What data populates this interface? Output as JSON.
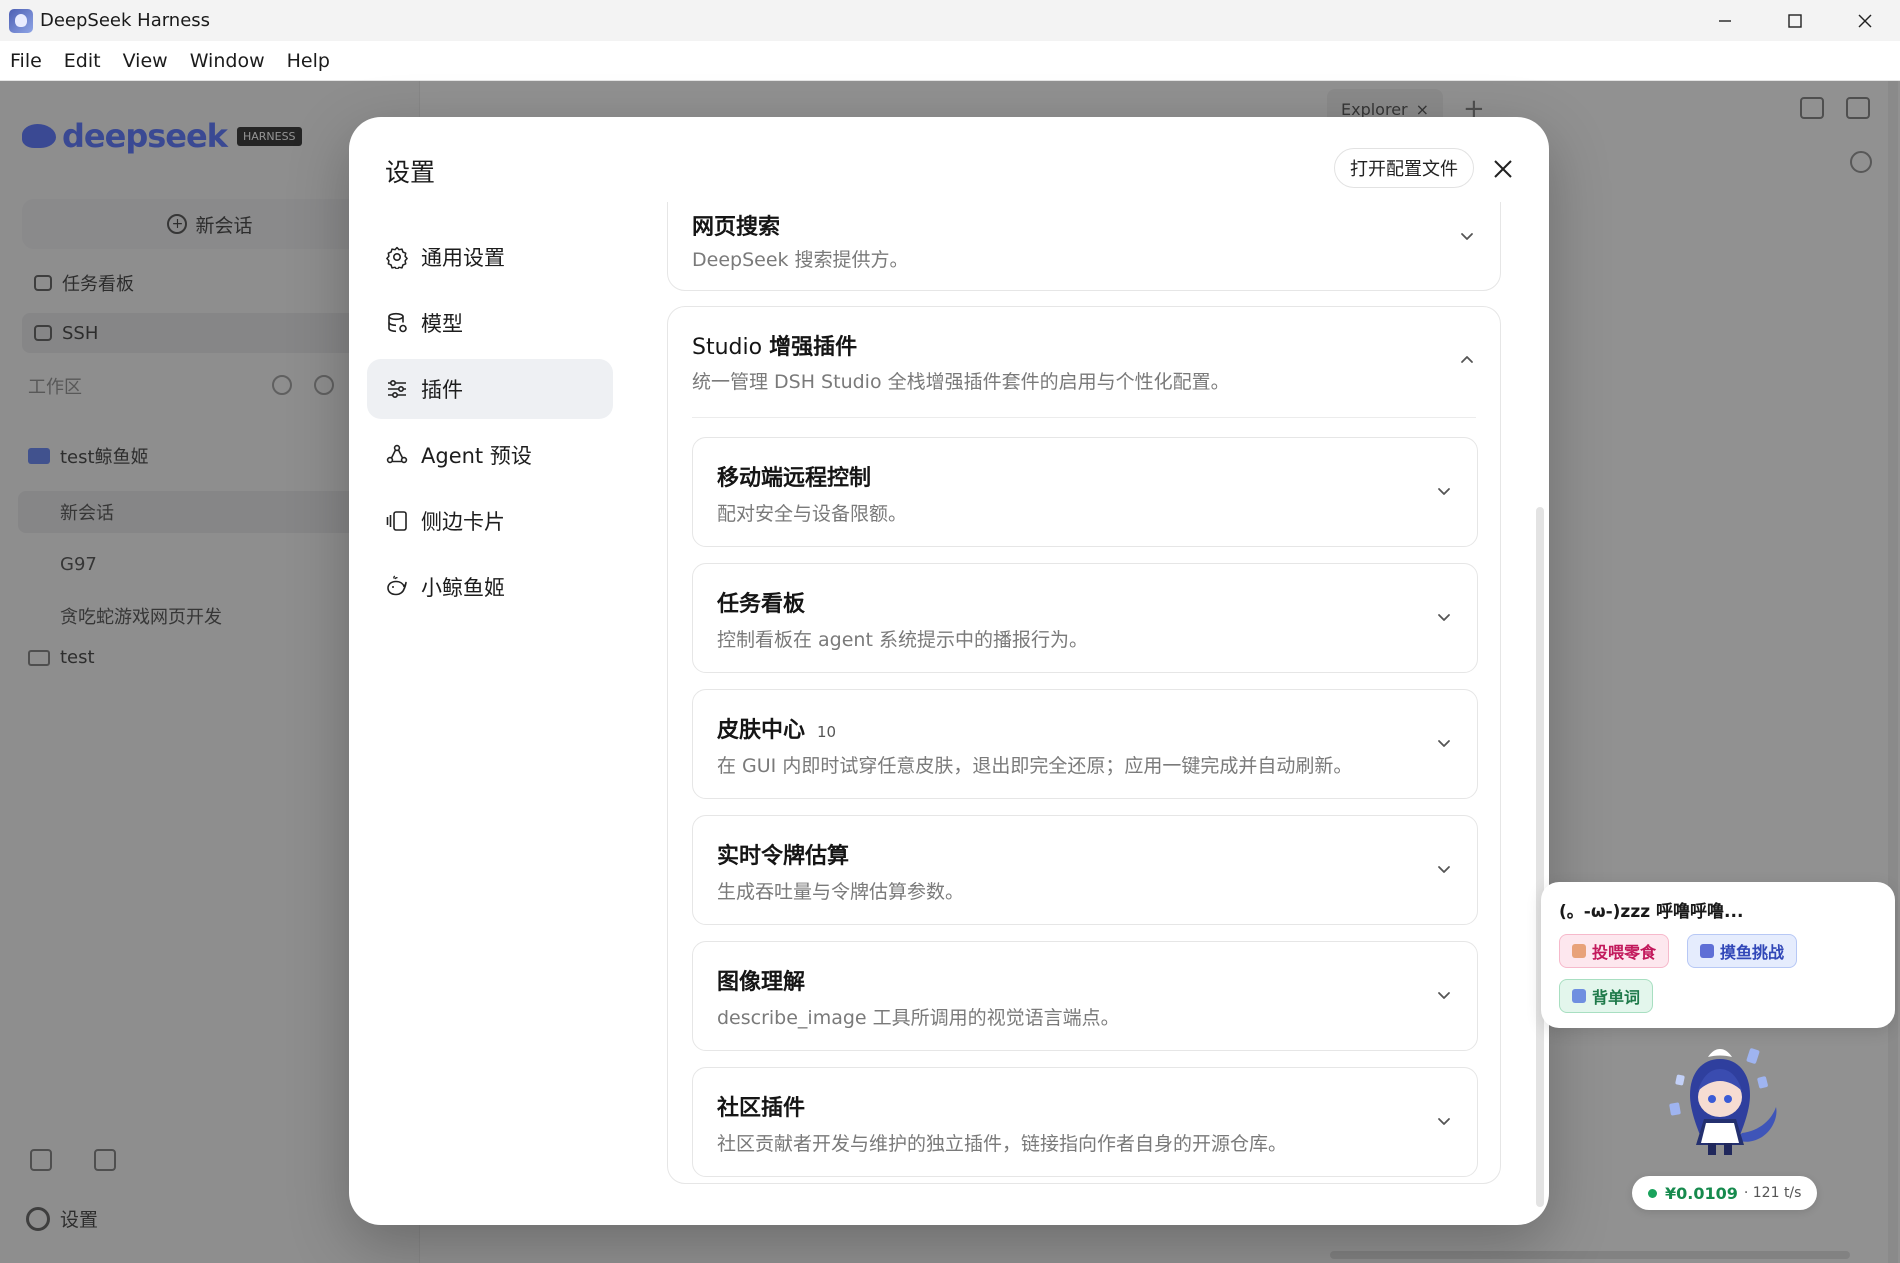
{
  "window": {
    "title": "DeepSeek Harness"
  },
  "menu": [
    "File",
    "Edit",
    "View",
    "Window",
    "Help"
  ],
  "background": {
    "logo_text": "deepseek",
    "logo_badge": "HARNESS",
    "new_chat": "新会话",
    "rows": [
      {
        "label": "任务看板"
      },
      {
        "label": "SSH"
      }
    ],
    "workspace_header": "工作区",
    "folders": [
      "test鲸鱼姬",
      "test"
    ],
    "chats": [
      "新会话",
      "G97",
      "贪吃蛇游戏网页开发"
    ],
    "settings_label": "设置",
    "tab_label": "Explorer"
  },
  "modal": {
    "title": "设置",
    "open_config": "打开配置文件",
    "nav": [
      {
        "label": "通用设置",
        "icon": "gear-icon"
      },
      {
        "label": "模型",
        "icon": "database-icon"
      },
      {
        "label": "插件",
        "icon": "sliders-icon"
      },
      {
        "label": "Agent 预设",
        "icon": "agent-icon"
      },
      {
        "label": "侧边卡片",
        "icon": "side-card-icon"
      },
      {
        "label": "小鲸鱼姬",
        "icon": "whale-icon"
      }
    ],
    "active_nav": 2,
    "web_search": {
      "title": "网页搜索",
      "desc": "DeepSeek 搜索提供方。"
    },
    "studio": {
      "title_prefix": "Studio",
      "title_main": "增强插件",
      "desc": "统一管理 DSH Studio 全栈增强插件套件的启用与个性化配置。",
      "items": [
        {
          "title": "移动端远程控制",
          "count": "",
          "desc": "配对安全与设备限额。"
        },
        {
          "title": "任务看板",
          "count": "",
          "desc": "控制看板在 agent 系统提示中的播报行为。"
        },
        {
          "title": "皮肤中心",
          "count": "10",
          "desc": "在 GUI 内即时试穿任意皮肤，退出即完全还原；应用一键完成并自动刷新。"
        },
        {
          "title": "实时令牌估算",
          "count": "",
          "desc": "生成吞吐量与令牌估算参数。"
        },
        {
          "title": "图像理解",
          "count": "",
          "desc": "describe_image 工具所调用的视觉语言端点。"
        },
        {
          "title": "社区插件",
          "count": "",
          "desc": "社区贡献者开发与维护的独立插件，链接指向作者自身的开源仓库。"
        }
      ]
    }
  },
  "mascot": {
    "bubble_text": "(。-ω-)zzz 呼噜呼噜...",
    "buttons": [
      "投喂零食",
      "摸鱼挑战",
      "背单词"
    ],
    "cost": "¥0.0109",
    "rate": "· 121 t/s"
  },
  "colors": {
    "accent": "#4d6bfe",
    "active_nav_bg": "#eef0f3",
    "cost_green": "#168a4d"
  }
}
